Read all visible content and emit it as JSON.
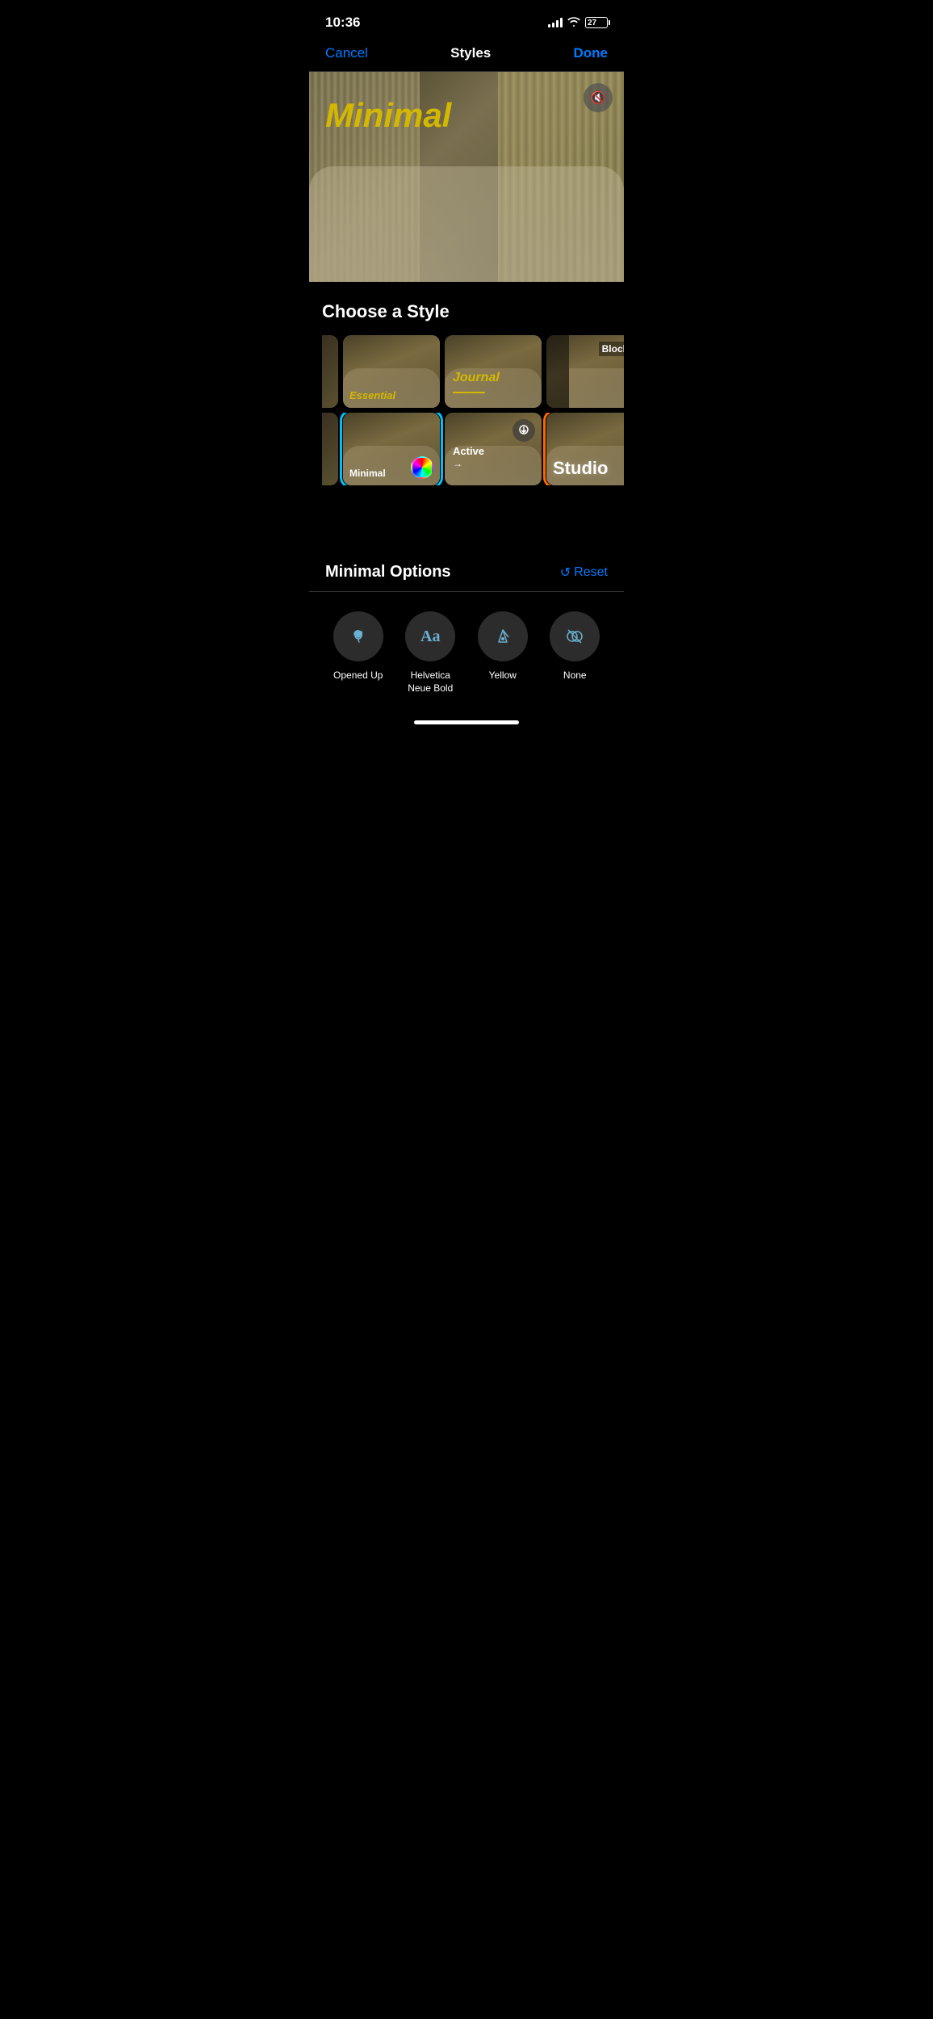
{
  "statusBar": {
    "time": "10:36",
    "battery": "27"
  },
  "navBar": {
    "cancel": "Cancel",
    "title": "Styles",
    "done": "Done"
  },
  "preview": {
    "text": "Minimal",
    "muteTitle": "mute"
  },
  "chooseStyle": {
    "title": "Choose a Style",
    "styles": [
      {
        "id": "essential",
        "label": "Essential",
        "labelClass": "yellow",
        "selected": false
      },
      {
        "id": "journal",
        "label": "Journal",
        "labelClass": "journal",
        "selected": false
      },
      {
        "id": "blocks",
        "label": "Blocks",
        "labelClass": "blocks-style",
        "selected": false
      },
      {
        "id": "minimal",
        "label": "Minimal",
        "labelClass": "yellow",
        "selected": true,
        "hasColorWheel": true
      },
      {
        "id": "active",
        "label": "Active",
        "labelClass": "active-style",
        "selected": false,
        "hasDownload": true
      },
      {
        "id": "studio",
        "label": "Studio",
        "labelClass": "studio",
        "selected": false,
        "orangeBorder": true
      }
    ]
  },
  "minimalOptions": {
    "title": "Minimal Options",
    "resetLabel": "Reset",
    "resetIcon": "↺",
    "options": [
      {
        "id": "opened-up",
        "label": "Opened Up",
        "icon": "♪"
      },
      {
        "id": "font",
        "label": "Helvetica\nNeue Bold",
        "icon": "Aa"
      },
      {
        "id": "color",
        "label": "Yellow",
        "icon": "✒"
      },
      {
        "id": "blend",
        "label": "None",
        "icon": "⊗"
      }
    ]
  }
}
